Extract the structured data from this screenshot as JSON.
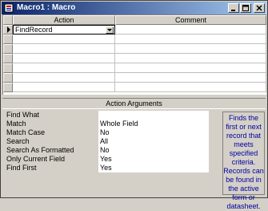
{
  "window": {
    "title": "Macro1 : Macro"
  },
  "grid": {
    "columns": [
      "Action",
      "Comment"
    ],
    "rows": [
      {
        "action": "FindRecord",
        "comment": "",
        "current": true
      }
    ]
  },
  "arguments_pane": {
    "title": "Action Arguments",
    "args": [
      {
        "label": "Find What",
        "value": ""
      },
      {
        "label": "Match",
        "value": "Whole Field"
      },
      {
        "label": "Match Case",
        "value": "No"
      },
      {
        "label": "Search",
        "value": "All"
      },
      {
        "label": "Search As Formatted",
        "value": "No"
      },
      {
        "label": "Only Current Field",
        "value": "Yes"
      },
      {
        "label": "Find First",
        "value": "Yes"
      }
    ],
    "help": "Finds the\nfirst or next\nrecord that\nmeets\nspecified\ncriteria.\nRecords can\nbe found in\nthe active\nform or\ndatasheet."
  },
  "icons": {
    "macro-icon": "macro",
    "current-row-indicator": "right-triangle",
    "dropdown-arrow": "chevron-down"
  },
  "colors": {
    "title_bar_start": "#0a246a",
    "title_bar_end": "#a6caf0",
    "help_text": "#0000a0",
    "face": "#d4d0c8"
  }
}
